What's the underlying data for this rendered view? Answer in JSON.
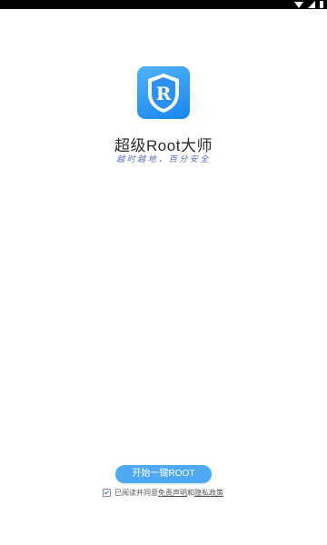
{
  "app": {
    "title": "超级Root大师",
    "slogan": "越时越地，百分安全",
    "logo_letter": "R"
  },
  "actions": {
    "start_label": "开始一键ROOT"
  },
  "agreement": {
    "checked": true,
    "prefix": "已阅读并同意",
    "disclaimer_link": "免责声明",
    "conjunction": "和",
    "privacy_link": "隐私政策"
  },
  "colors": {
    "brand_blue": "#1a86ee",
    "button_blue": "#4fa8f2",
    "slogan_color": "#5b6cb5"
  },
  "icons": {
    "status_bar": [
      "wifi-icon",
      "signal-icon",
      "battery-icon"
    ],
    "logo": "shield-r-logo-icon",
    "checkbox": "check-icon"
  }
}
